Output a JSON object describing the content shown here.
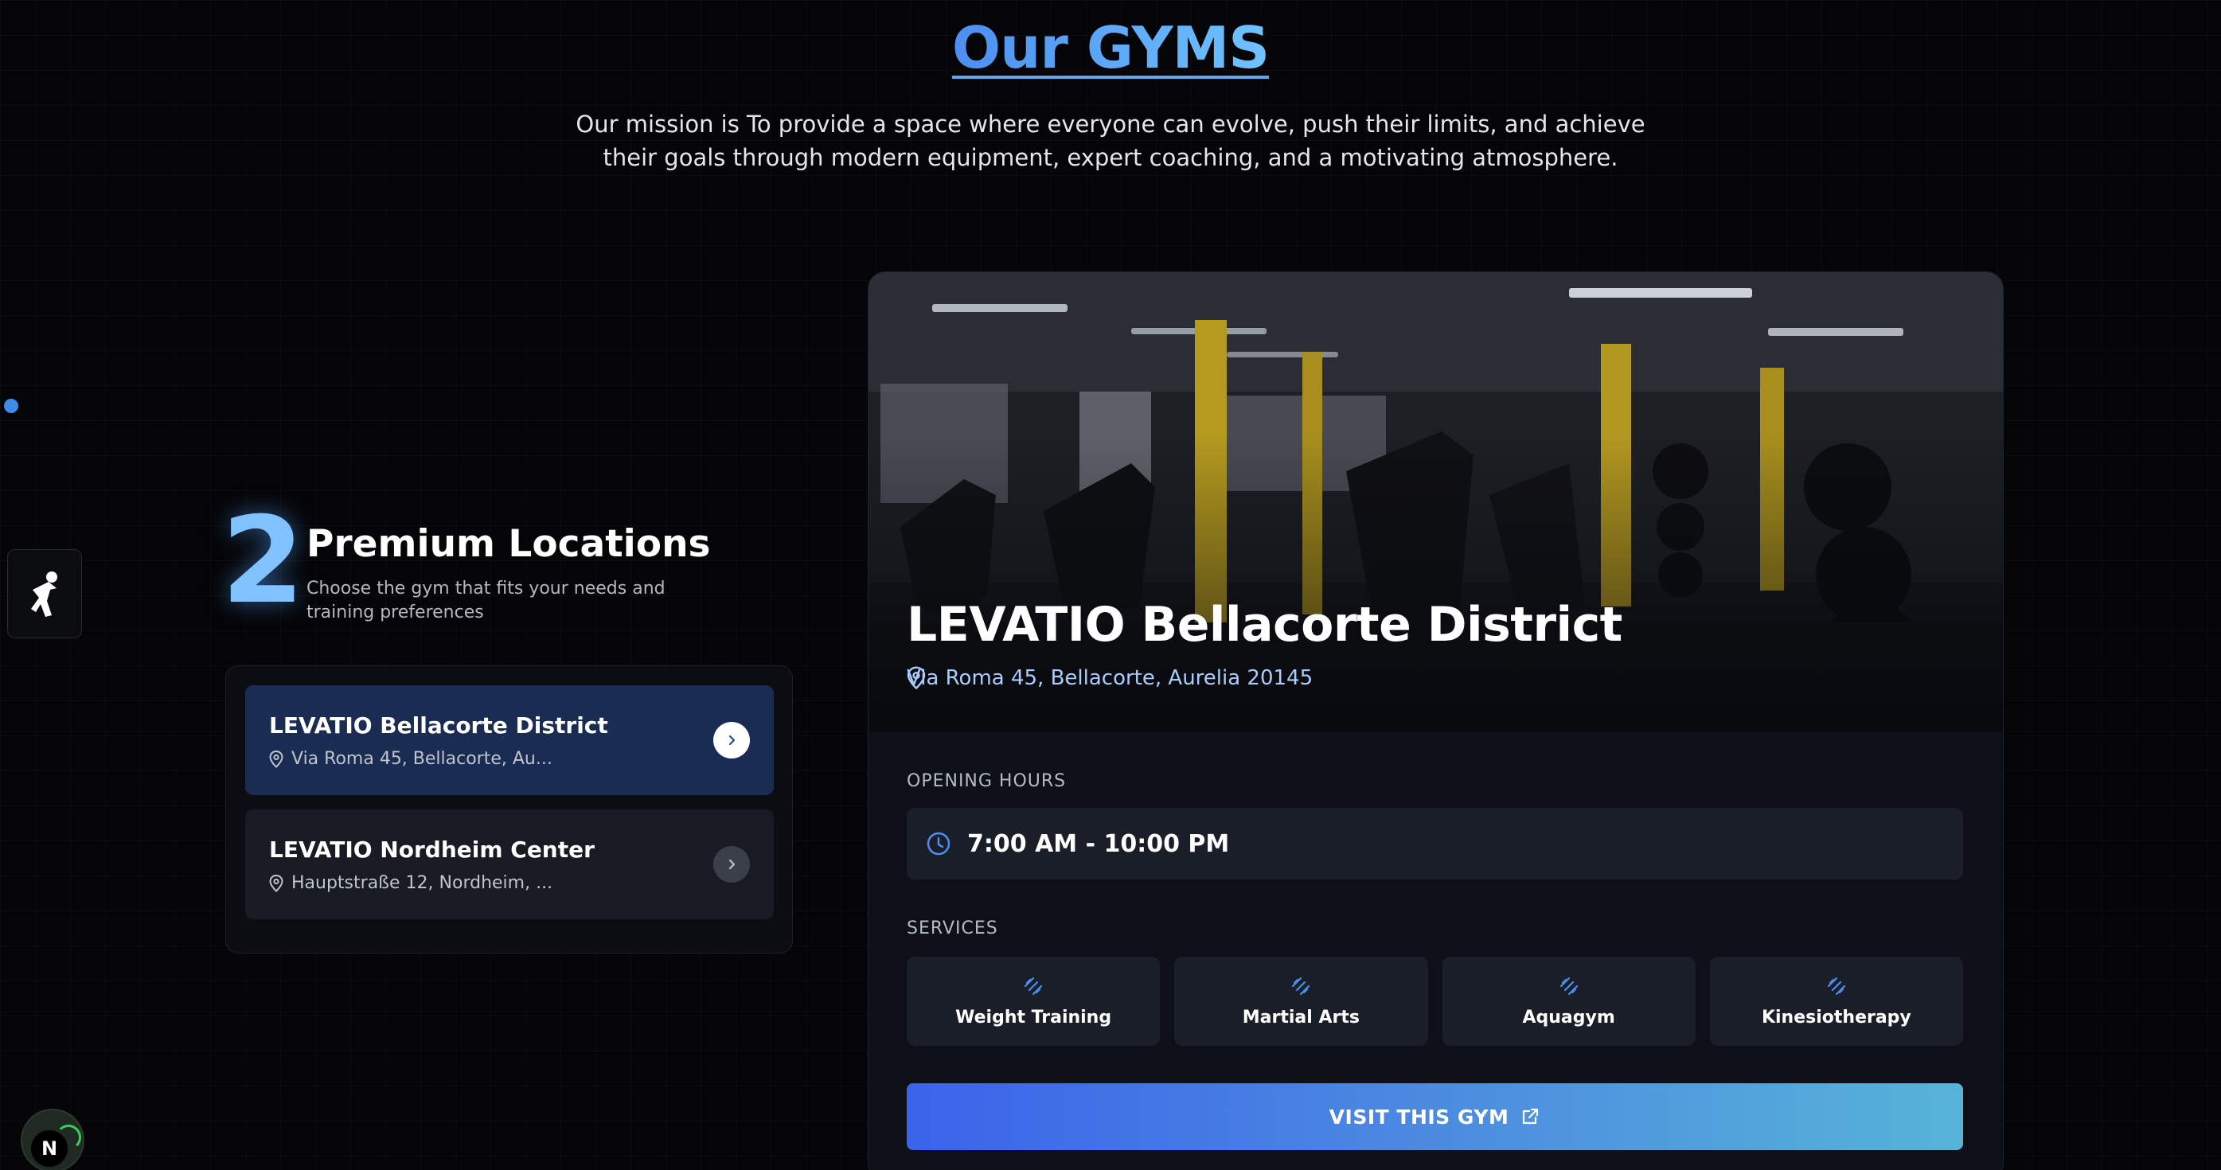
{
  "header": {
    "title": "Our GYMS",
    "mission": "Our mission is To provide a space where everyone can evolve, push their limits, and achieve their goals through modern equipment, expert coaching, and a motivating atmosphere."
  },
  "locations": {
    "count": "2",
    "title": "Premium Locations",
    "subtitle": "Choose the gym that fits your needs and training preferences",
    "items": [
      {
        "name": "LEVATIO Bellacorte District",
        "address": "Via Roma 45, Bellacorte, Au...",
        "selected": true
      },
      {
        "name": "LEVATIO Nordheim Center",
        "address": "Hauptstraße 12, Nordheim, ...",
        "selected": false
      }
    ]
  },
  "gym": {
    "name": "LEVATIO Bellacorte District",
    "address": "Via Roma 45, Bellacorte, Aurelia 20145",
    "hours_label": "OPENING HOURS",
    "hours": "7:00 AM - 10:00 PM",
    "services_label": "SERVICES",
    "services": [
      "Weight Training",
      "Martial Arts",
      "Aquagym",
      "Kinesiotherapy"
    ],
    "visit_label": "VISIT THIS GYM"
  },
  "badge": {
    "letter": "N"
  },
  "colors": {
    "accent": "#4c8ef0",
    "accent_light": "#7fc2ff",
    "button_start": "#3b63ea",
    "button_end": "#56b4d8",
    "card_bg": "#1a1e29",
    "selected_card": "#1a2c52"
  },
  "icons": {
    "location": "map-pin-icon",
    "clock": "clock-icon",
    "service": "dumbbell-icon",
    "chevron": "chevron-right-icon",
    "external": "external-link-icon",
    "side_widget": "exercise-figure-icon"
  }
}
